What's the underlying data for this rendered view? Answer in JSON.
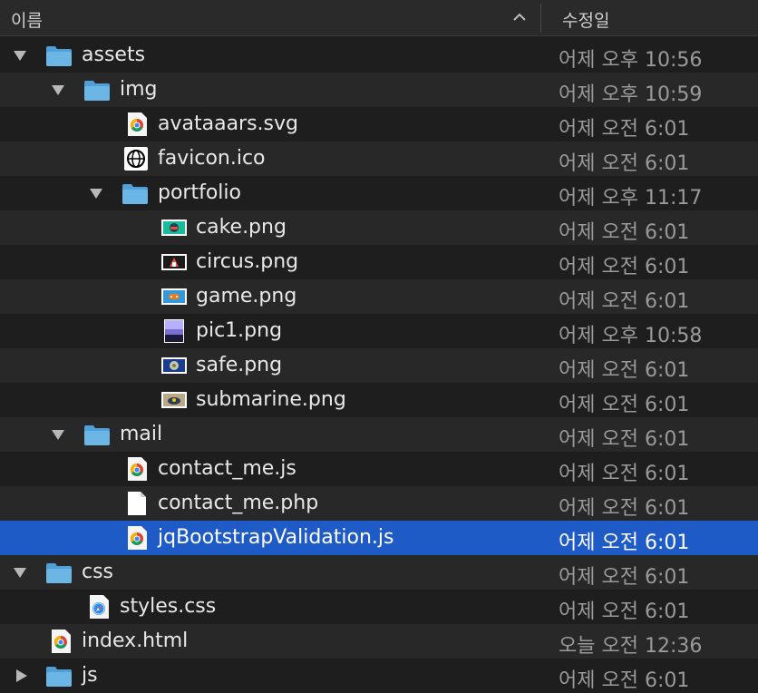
{
  "header": {
    "name_col": "이름",
    "date_col": "수정일",
    "sort_icon": "chevron-up-icon"
  },
  "colors": {
    "folder": "#6cb6e6",
    "selected": "#1f5bc7",
    "text": "#e8e8e8",
    "date": "#9a9a9a"
  },
  "rows": [
    {
      "name": "assets",
      "date": "어제 오후 10:56",
      "icon": "folder-icon",
      "expanded": true
    },
    {
      "name": "img",
      "date": "어제 오후 10:59",
      "icon": "folder-icon",
      "expanded": true
    },
    {
      "name": "avataaars.svg",
      "date": "어제 오전 6:01",
      "icon": "chrome-file-icon"
    },
    {
      "name": "favicon.ico",
      "date": "어제 오전 6:01",
      "icon": "globe-icon"
    },
    {
      "name": "portfolio",
      "date": "어제 오후 11:17",
      "icon": "folder-icon",
      "expanded": true
    },
    {
      "name": "cake.png",
      "date": "어제 오전 6:01",
      "icon": "image-thumbnail-icon"
    },
    {
      "name": "circus.png",
      "date": "어제 오전 6:01",
      "icon": "image-thumbnail-icon"
    },
    {
      "name": "game.png",
      "date": "어제 오전 6:01",
      "icon": "image-thumbnail-icon"
    },
    {
      "name": "pic1.png",
      "date": "어제 오후 10:58",
      "icon": "image-thumbnail-icon"
    },
    {
      "name": "safe.png",
      "date": "어제 오전 6:01",
      "icon": "image-thumbnail-icon"
    },
    {
      "name": "submarine.png",
      "date": "어제 오전 6:01",
      "icon": "image-thumbnail-icon"
    },
    {
      "name": "mail",
      "date": "어제 오전 6:01",
      "icon": "folder-icon",
      "expanded": true
    },
    {
      "name": "contact_me.js",
      "date": "어제 오전 6:01",
      "icon": "chrome-file-icon"
    },
    {
      "name": "contact_me.php",
      "date": "어제 오전 6:01",
      "icon": "blank-file-icon"
    },
    {
      "name": "jqBootstrapValidation.js",
      "date": "어제 오전 6:01",
      "icon": "chrome-file-icon",
      "selected": true
    },
    {
      "name": "css",
      "date": "어제 오전 6:01",
      "icon": "folder-icon",
      "expanded": true
    },
    {
      "name": "styles.css",
      "date": "어제 오전 6:01",
      "icon": "safari-file-icon"
    },
    {
      "name": "index.html",
      "date": "오늘 오전 12:36",
      "icon": "chrome-file-icon"
    },
    {
      "name": "js",
      "date": "어제 오전 6:01",
      "icon": "folder-icon",
      "expanded": false
    }
  ]
}
